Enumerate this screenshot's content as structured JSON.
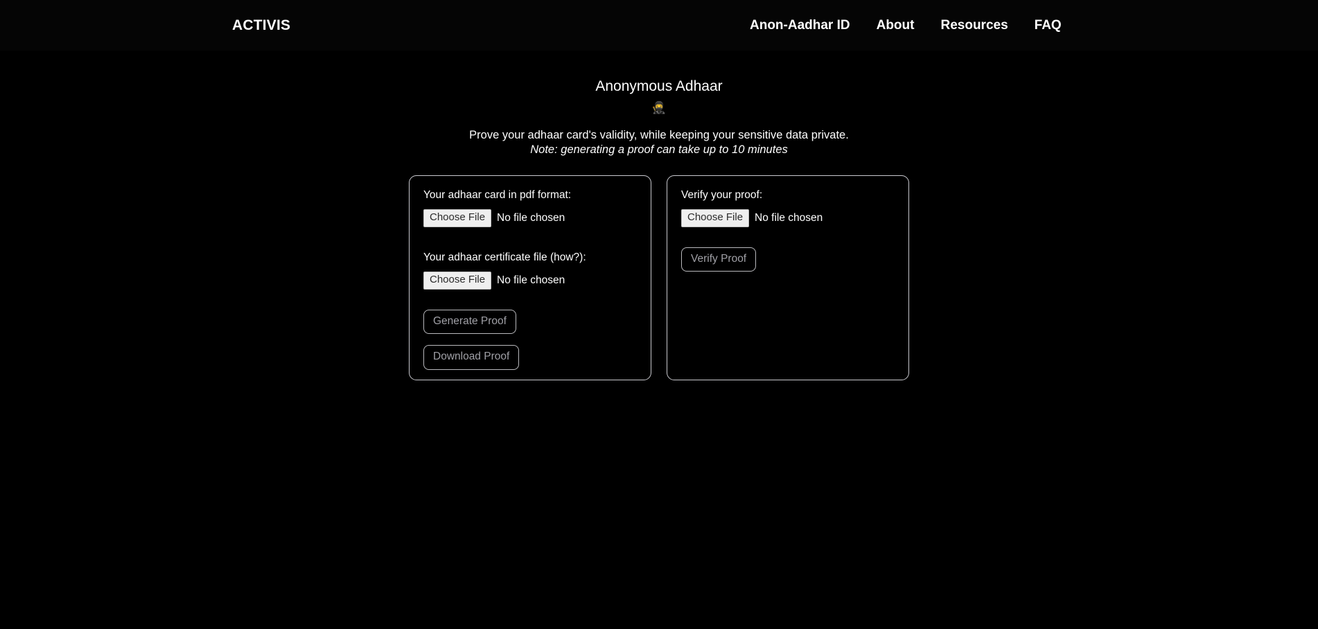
{
  "header": {
    "brand": "ACTIVIS",
    "nav": [
      {
        "label": "Anon-Aadhar ID"
      },
      {
        "label": "About"
      },
      {
        "label": "Resources"
      },
      {
        "label": "FAQ"
      }
    ]
  },
  "hero": {
    "title": "Anonymous Adhaar",
    "emoji": "🥷",
    "emoji_name": "ninja-emoji",
    "subtitle": "Prove your adhaar card's validity, while keeping your sensitive data private.",
    "note": "Note: generating a proof can take up to 10 minutes"
  },
  "generate_card": {
    "pdf_label": "Your adhaar card in pdf format:",
    "pdf_file_button": "Choose File",
    "pdf_file_status": "No file chosen",
    "cert_label": "Your adhaar certificate file (how?):",
    "cert_file_button": "Choose File",
    "cert_file_status": "No file chosen",
    "generate_button": "Generate Proof",
    "download_button": "Download Proof"
  },
  "verify_card": {
    "label": "Verify your proof:",
    "file_button": "Choose File",
    "file_status": "No file chosen",
    "verify_button": "Verify Proof"
  },
  "colors": {
    "page_background": "#000000",
    "navbar_background": "#050505",
    "text": "#ffffff",
    "card_border": "#c9c9cf",
    "action_button_border": "#b9b9bd",
    "action_button_text": "#a0a0a6",
    "file_button_background": "#efefef",
    "file_button_text": "#2b2b2b"
  }
}
